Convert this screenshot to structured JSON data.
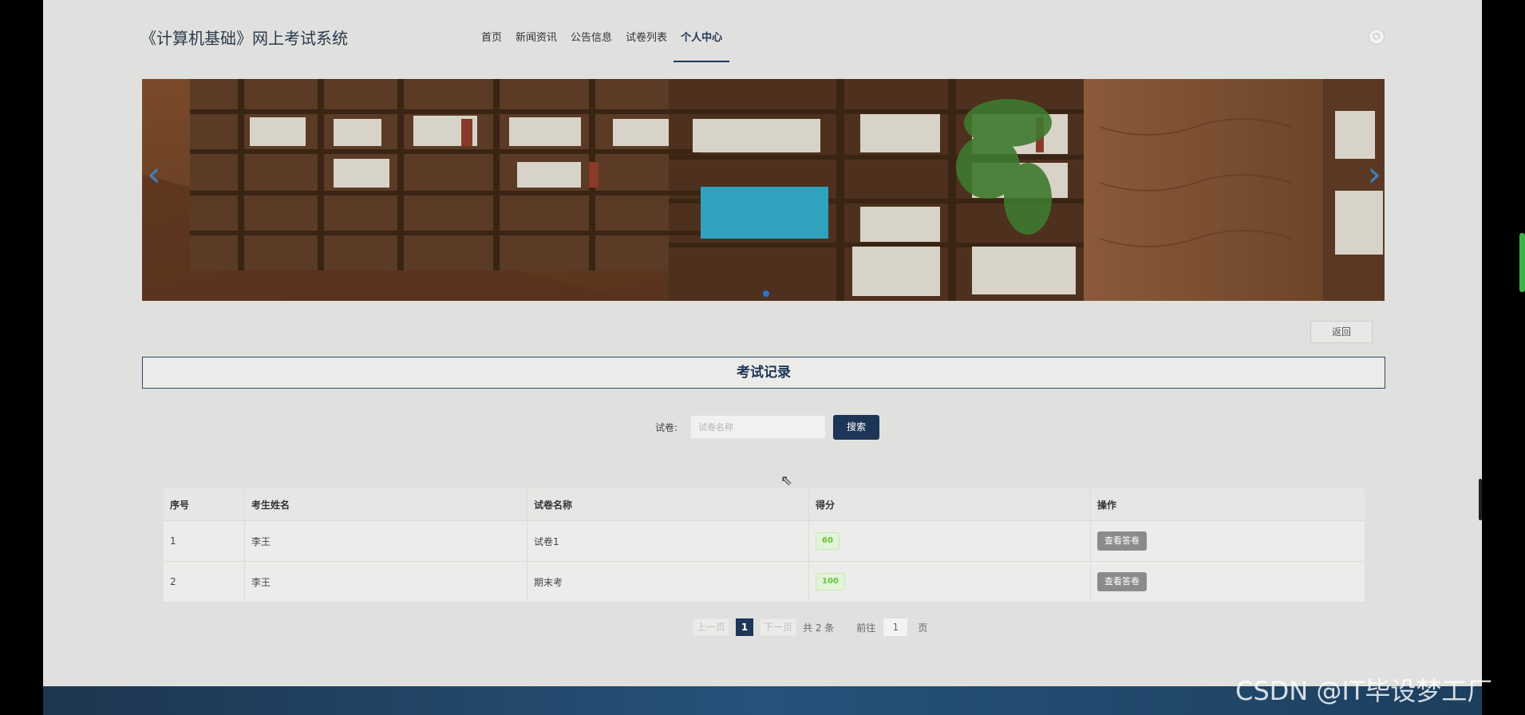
{
  "header": {
    "site_title": "《计算机基础》网上考试系统",
    "nav": [
      {
        "label": "首页",
        "active": false
      },
      {
        "label": "新闻资讯",
        "active": false
      },
      {
        "label": "公告信息",
        "active": false
      },
      {
        "label": "试卷列表",
        "active": false
      },
      {
        "label": "个人中心",
        "active": true
      }
    ],
    "power_icon": "power-icon"
  },
  "banner": {
    "prev_arrow": "‹",
    "next_arrow": "›",
    "active_slide": 1,
    "slide_count": 1
  },
  "back_label": "返回",
  "section_title": "考试记录",
  "search": {
    "label": "试卷:",
    "placeholder": "试卷名称",
    "button": "搜索"
  },
  "table": {
    "headers": [
      "序号",
      "考生姓名",
      "试卷名称",
      "得分",
      "操作"
    ],
    "rows": [
      {
        "index": "1",
        "name": "李王",
        "paper": "试卷1",
        "score": "60",
        "action": "查看答卷"
      },
      {
        "index": "2",
        "name": "李王",
        "paper": "期末考",
        "score": "100",
        "action": "查看答卷"
      }
    ]
  },
  "pagination": {
    "prev": "上一页",
    "current": "1",
    "next": "下一页",
    "total": "共 2 条",
    "goto_label": "前往",
    "goto_value": "1",
    "page_suffix": "页"
  },
  "watermark": "CSDN @IT毕设梦工厂",
  "colors": {
    "primary": "#1d3557",
    "score_green": "#67c23a",
    "view_button": "#8b8b8b"
  }
}
